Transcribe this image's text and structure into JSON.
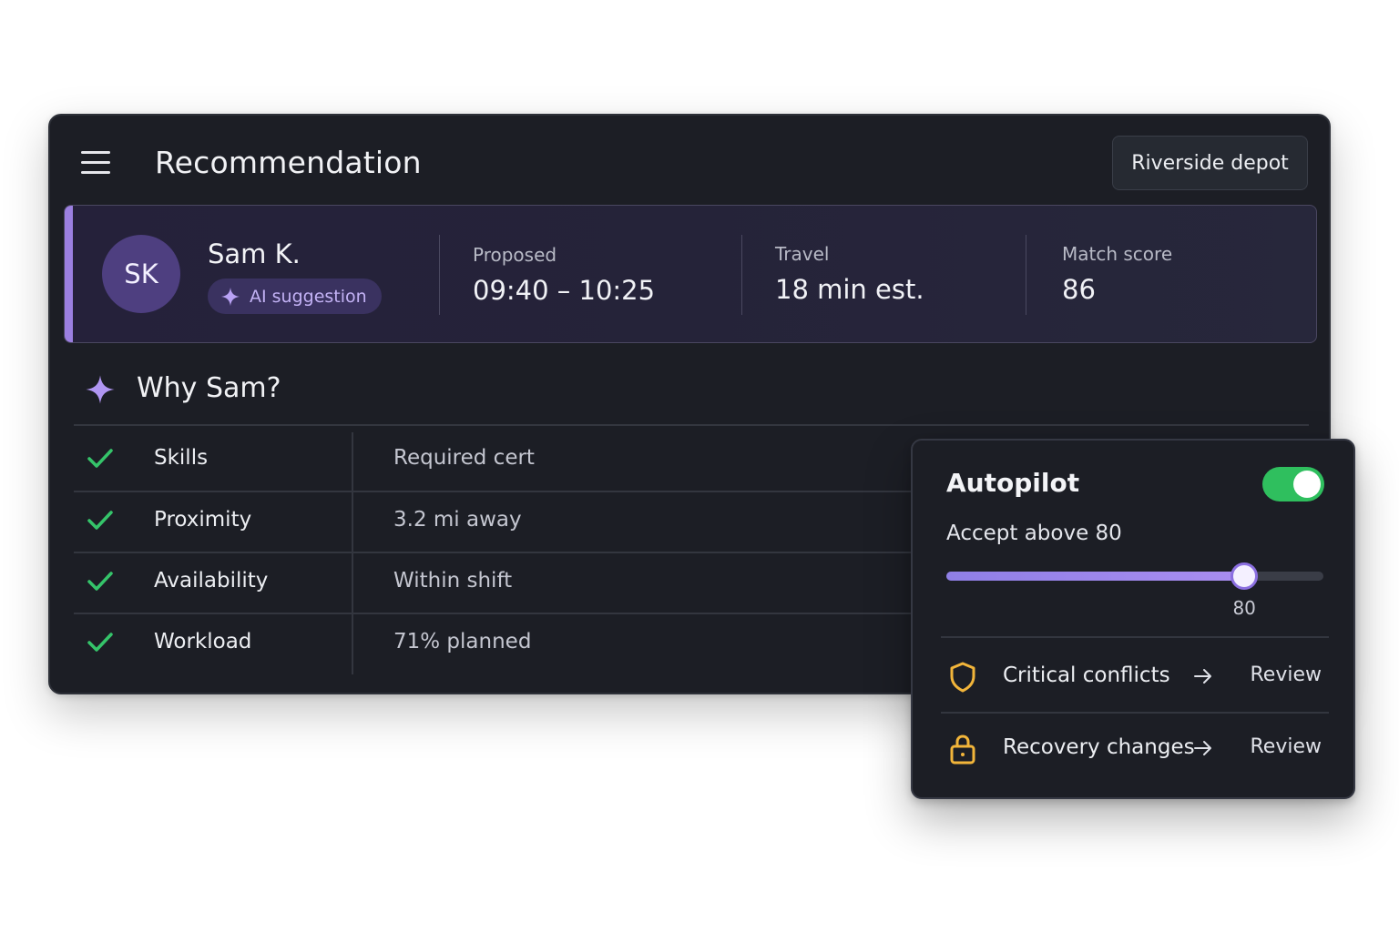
{
  "header": {
    "title": "Recommendation",
    "depot_label": "Riverside depot",
    "menu_icon": "hamburger-menu-icon"
  },
  "recommendation": {
    "avatar_initials": "SK",
    "name": "Sam K.",
    "badge": {
      "icon": "sparkle-icon",
      "label": "AI suggestion"
    },
    "stats": [
      {
        "label": "Proposed",
        "value": "09:40 – 10:25"
      },
      {
        "label": "Travel",
        "value": "18 min est."
      },
      {
        "label": "Match score",
        "value": "86"
      }
    ]
  },
  "why": {
    "icon": "sparkle-icon",
    "title": "Why Sam?",
    "reasons": [
      {
        "icon": "check-icon",
        "label": "Skills",
        "value": "Required cert"
      },
      {
        "icon": "check-icon",
        "label": "Proximity",
        "value": "3.2 mi away"
      },
      {
        "icon": "check-icon",
        "label": "Availability",
        "value": "Within shift"
      },
      {
        "icon": "check-icon",
        "label": "Workload",
        "value": "71% planned"
      }
    ]
  },
  "autopilot": {
    "title": "Autopilot",
    "enabled": true,
    "threshold_label": "Accept above 80",
    "slider": {
      "min": 0,
      "max": 100,
      "value": 80,
      "value_label": "80"
    },
    "rows": [
      {
        "icon": "shield-icon",
        "label": "Critical conflicts",
        "arrow": "arrow-right-icon",
        "action": "Review"
      },
      {
        "icon": "lock-icon",
        "label": "Recovery changes",
        "arrow": "arrow-right-icon",
        "action": "Review"
      }
    ]
  },
  "colors": {
    "accent_purple": "#9b7fe0",
    "toggle_on": "#2fbf5e",
    "check_green": "#35c46a",
    "warning_amber": "#f2b53a",
    "card_bg": "#1c1e25"
  }
}
